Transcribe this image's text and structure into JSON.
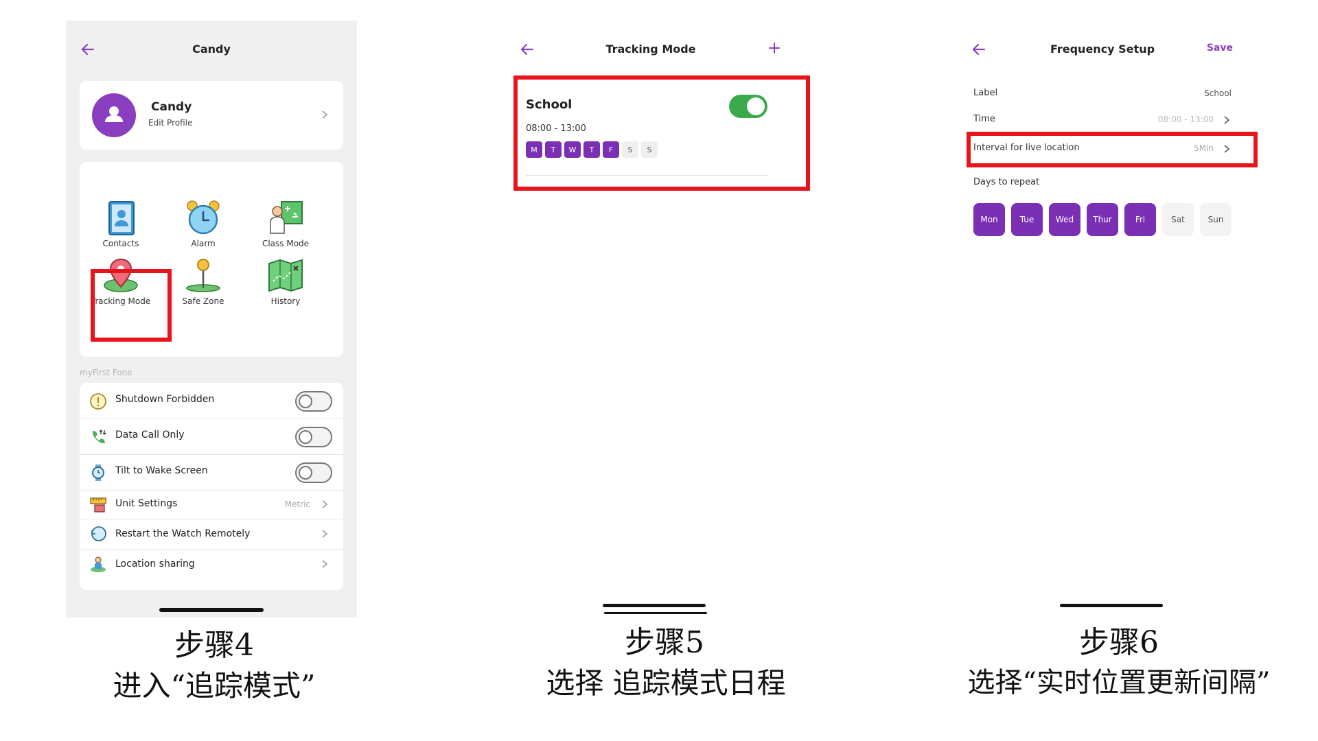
{
  "panel1": {
    "title": "Candy",
    "profile": {
      "name": "Candy",
      "subtitle": "Edit Profile"
    },
    "grid": [
      {
        "label": "Contacts",
        "icon": "contacts-icon"
      },
      {
        "label": "Alarm",
        "icon": "alarm-clock-icon"
      },
      {
        "label": "Class Mode",
        "icon": "class-mode-icon"
      },
      {
        "label": "Tracking Mode",
        "icon": "map-pin-icon"
      },
      {
        "label": "Safe Zone",
        "icon": "safe-zone-pin-icon"
      },
      {
        "label": "History",
        "icon": "map-history-icon"
      }
    ],
    "section_label": "myFirst Fone",
    "settings": [
      {
        "label": "Shutdown Forbidden",
        "icon": "warning-circle-icon",
        "type": "toggle",
        "value": ""
      },
      {
        "label": "Data Call Only",
        "icon": "phone-data-icon",
        "type": "toggle",
        "value": ""
      },
      {
        "label": "Tilt to Wake Screen",
        "icon": "watch-icon",
        "type": "toggle",
        "value": ""
      },
      {
        "label": "Unit Settings",
        "icon": "ruler-icon",
        "type": "link",
        "value": "Metric"
      },
      {
        "label": "Restart the Watch Remotely",
        "icon": "restart-icon",
        "type": "link",
        "value": ""
      },
      {
        "label": "Location sharing",
        "icon": "location-sharing-icon",
        "type": "link",
        "value": ""
      }
    ]
  },
  "panel2": {
    "title": "Tracking Mode",
    "schedule": {
      "name": "School",
      "time": "08:00 - 13:00",
      "days": [
        {
          "d": "M",
          "on": true
        },
        {
          "d": "T",
          "on": true
        },
        {
          "d": "W",
          "on": true
        },
        {
          "d": "T",
          "on": true
        },
        {
          "d": "F",
          "on": true
        },
        {
          "d": "S",
          "on": false
        },
        {
          "d": "S",
          "on": false
        }
      ]
    }
  },
  "panel3": {
    "title": "Frequency Setup",
    "action": "Save",
    "label_row": {
      "label": "Label",
      "value": "School"
    },
    "time_row": {
      "label": "Time",
      "value": "08:00 - 13:00"
    },
    "interval_row": {
      "label": "Interval for live location",
      "value": "5Min"
    },
    "days_label": "Days to repeat",
    "days": [
      {
        "d": "Mon",
        "on": true
      },
      {
        "d": "Tue",
        "on": true
      },
      {
        "d": "Wed",
        "on": true
      },
      {
        "d": "Thur",
        "on": true
      },
      {
        "d": "Fri",
        "on": true
      },
      {
        "d": "Sat",
        "on": false
      },
      {
        "d": "Sun",
        "on": false
      }
    ]
  },
  "captions": [
    {
      "step": "步骤4",
      "text": "进入“追踪模式”"
    },
    {
      "step": "步骤5",
      "text": "选择 追踪模式日程"
    },
    {
      "step": "步骤6",
      "text": "选择“实时位置更新间隔”"
    }
  ],
  "colors": {
    "accent": "#8a3fc1",
    "day_on": "#7b2fb5",
    "highlight": "#e8141b",
    "toggle_on": "#3aaa4a"
  }
}
